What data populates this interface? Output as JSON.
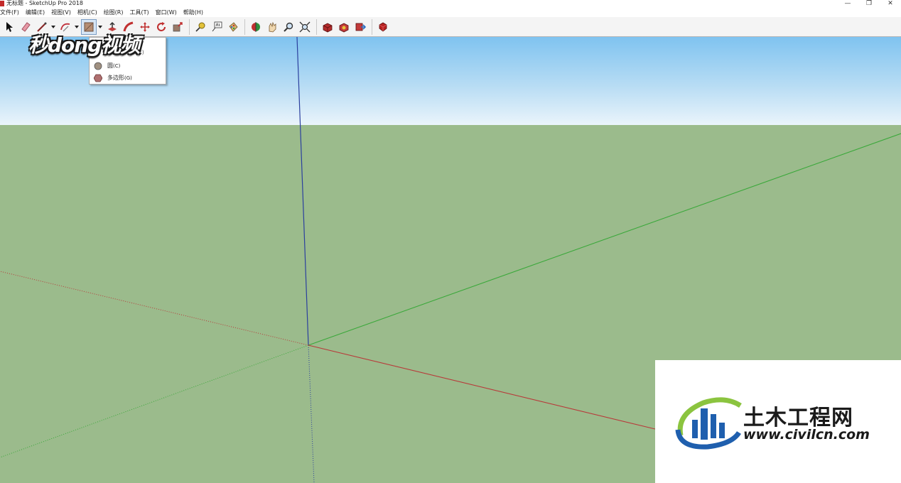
{
  "window": {
    "title": "无标题 - SketchUp Pro 2018",
    "controls": [
      "minimize",
      "restore",
      "close"
    ]
  },
  "menu": [
    "文件(F)",
    "编辑(E)",
    "视图(V)",
    "相机(C)",
    "绘图(R)",
    "工具(T)",
    "窗口(W)",
    "帮助(H)"
  ],
  "toolbar": {
    "tools": [
      "select-icon",
      "eraser-icon",
      "line-icon",
      "arc-icon",
      "shape-icon",
      "push-pull-icon",
      "follow-me-icon",
      "move-icon",
      "rotate-icon",
      "scale-icon",
      "tape-measure-icon",
      "text-icon",
      "paint-bucket-icon",
      "orbit-icon",
      "pan-icon",
      "zoom-icon",
      "zoom-extents-icon",
      "warehouse-icon",
      "extension-icon",
      "share-model-icon",
      "ruby-icon"
    ],
    "active_tool": "shape-icon"
  },
  "shape_menu": {
    "partial_label": "旋转长方形(R)",
    "items": [
      {
        "icon": "circle-icon",
        "label": "圆",
        "shortcut": "(C)"
      },
      {
        "icon": "polygon-icon",
        "label": "多边形",
        "shortcut": "(G)"
      }
    ]
  },
  "watermark": {
    "text": "秒dong视频"
  },
  "logo": {
    "name": "土木工程网",
    "url": "www.civilcn.com"
  },
  "colors": {
    "sky_top": "#7fc3f0",
    "ground": "#9bbb8c",
    "axis_red": "#b83a3a",
    "axis_green": "#3aa83a",
    "axis_blue": "#2b3f9e",
    "logo_blue": "#1f5fae",
    "logo_green": "#8bc43f"
  }
}
